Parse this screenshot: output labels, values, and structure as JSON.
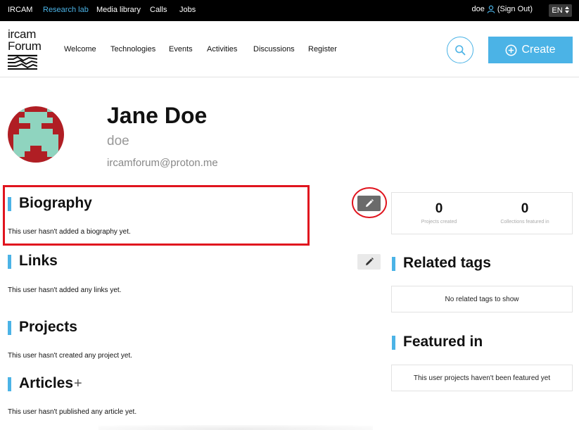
{
  "topbar": {
    "links": [
      "IRCAM",
      "Research lab",
      "Media library",
      "Calls",
      "Jobs"
    ],
    "active_link": "Research lab",
    "user": "doe",
    "sign_out": "(Sign Out)",
    "language": "EN"
  },
  "header": {
    "logo_line1": "ircam",
    "logo_line2": "Forum",
    "nav": [
      "Welcome",
      "Technologies",
      "Events",
      "Activities",
      "Discussions",
      "Register"
    ],
    "create_label": "Create"
  },
  "profile": {
    "name": "Jane Doe",
    "username": "doe",
    "email": "ircamforum@proton.me"
  },
  "sections": {
    "biography": {
      "title": "Biography",
      "text": "This user hasn't added a biography yet."
    },
    "links": {
      "title": "Links",
      "text": "This user hasn't added any links yet."
    },
    "projects": {
      "title": "Projects",
      "text": "This user hasn't created any project yet."
    },
    "articles": {
      "title": "Articles",
      "text": "This user hasn't published any article yet.",
      "add_symbol": "+"
    }
  },
  "stats": {
    "projects_created": {
      "value": "0",
      "label": "Projects created"
    },
    "collections_featured": {
      "value": "0",
      "label": "Collections featured in"
    }
  },
  "related_tags": {
    "title": "Related tags",
    "empty": "No related tags to show"
  },
  "featured_in": {
    "title": "Featured in",
    "empty": "This user projects haven't been featured yet"
  },
  "colors": {
    "accent": "#4bb3e6",
    "highlight": "#e0141e",
    "avatar_bg": "#b01e24",
    "avatar_fg": "#8fd4bf"
  },
  "icons": [
    "user-icon",
    "sort-icon",
    "search-icon",
    "plus-circle-icon",
    "pencil-icon",
    "plus-icon"
  ]
}
